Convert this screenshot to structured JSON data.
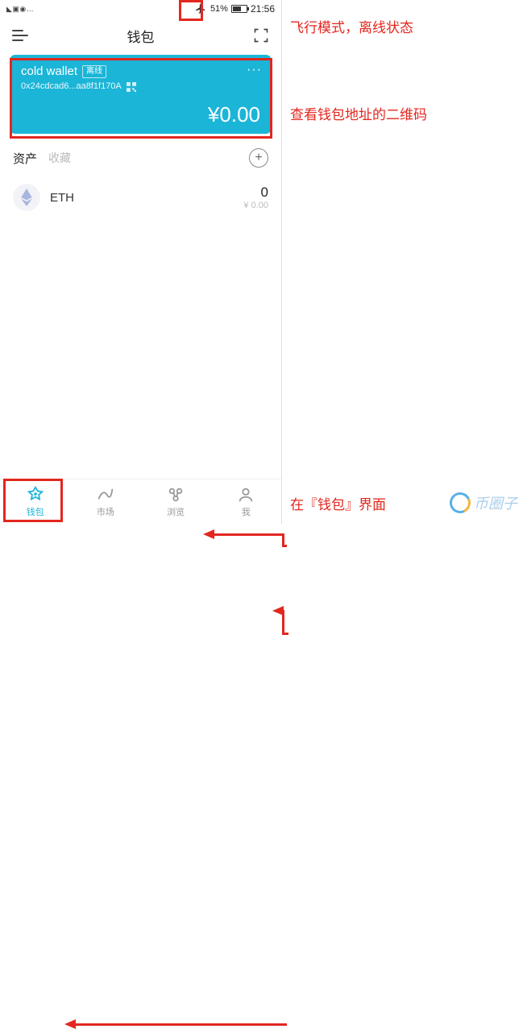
{
  "status_bar": {
    "icons_left": "◣ ▣ ◉ …",
    "battery_pct": "51%",
    "time": "21:56"
  },
  "top_nav": {
    "title": "钱包"
  },
  "wallet_card": {
    "name": "cold wallet",
    "offline_badge": "离线",
    "address": "0x24cdcad6...aa8f1f170A",
    "balance": "¥0.00",
    "more": "···"
  },
  "section": {
    "assets_label": "资产",
    "collect_label": "收藏"
  },
  "assets": [
    {
      "symbol": "ETH",
      "amount": "0",
      "fiat": "¥ 0.00"
    }
  ],
  "tab_bar": {
    "wallet": "钱包",
    "market": "市场",
    "browser": "浏览",
    "me": "我"
  },
  "annotations": {
    "airplane": "飞行模式，离线状态",
    "qr": "查看钱包地址的二维码",
    "tab": "在『钱包』界面"
  },
  "watermark": "币圈子"
}
